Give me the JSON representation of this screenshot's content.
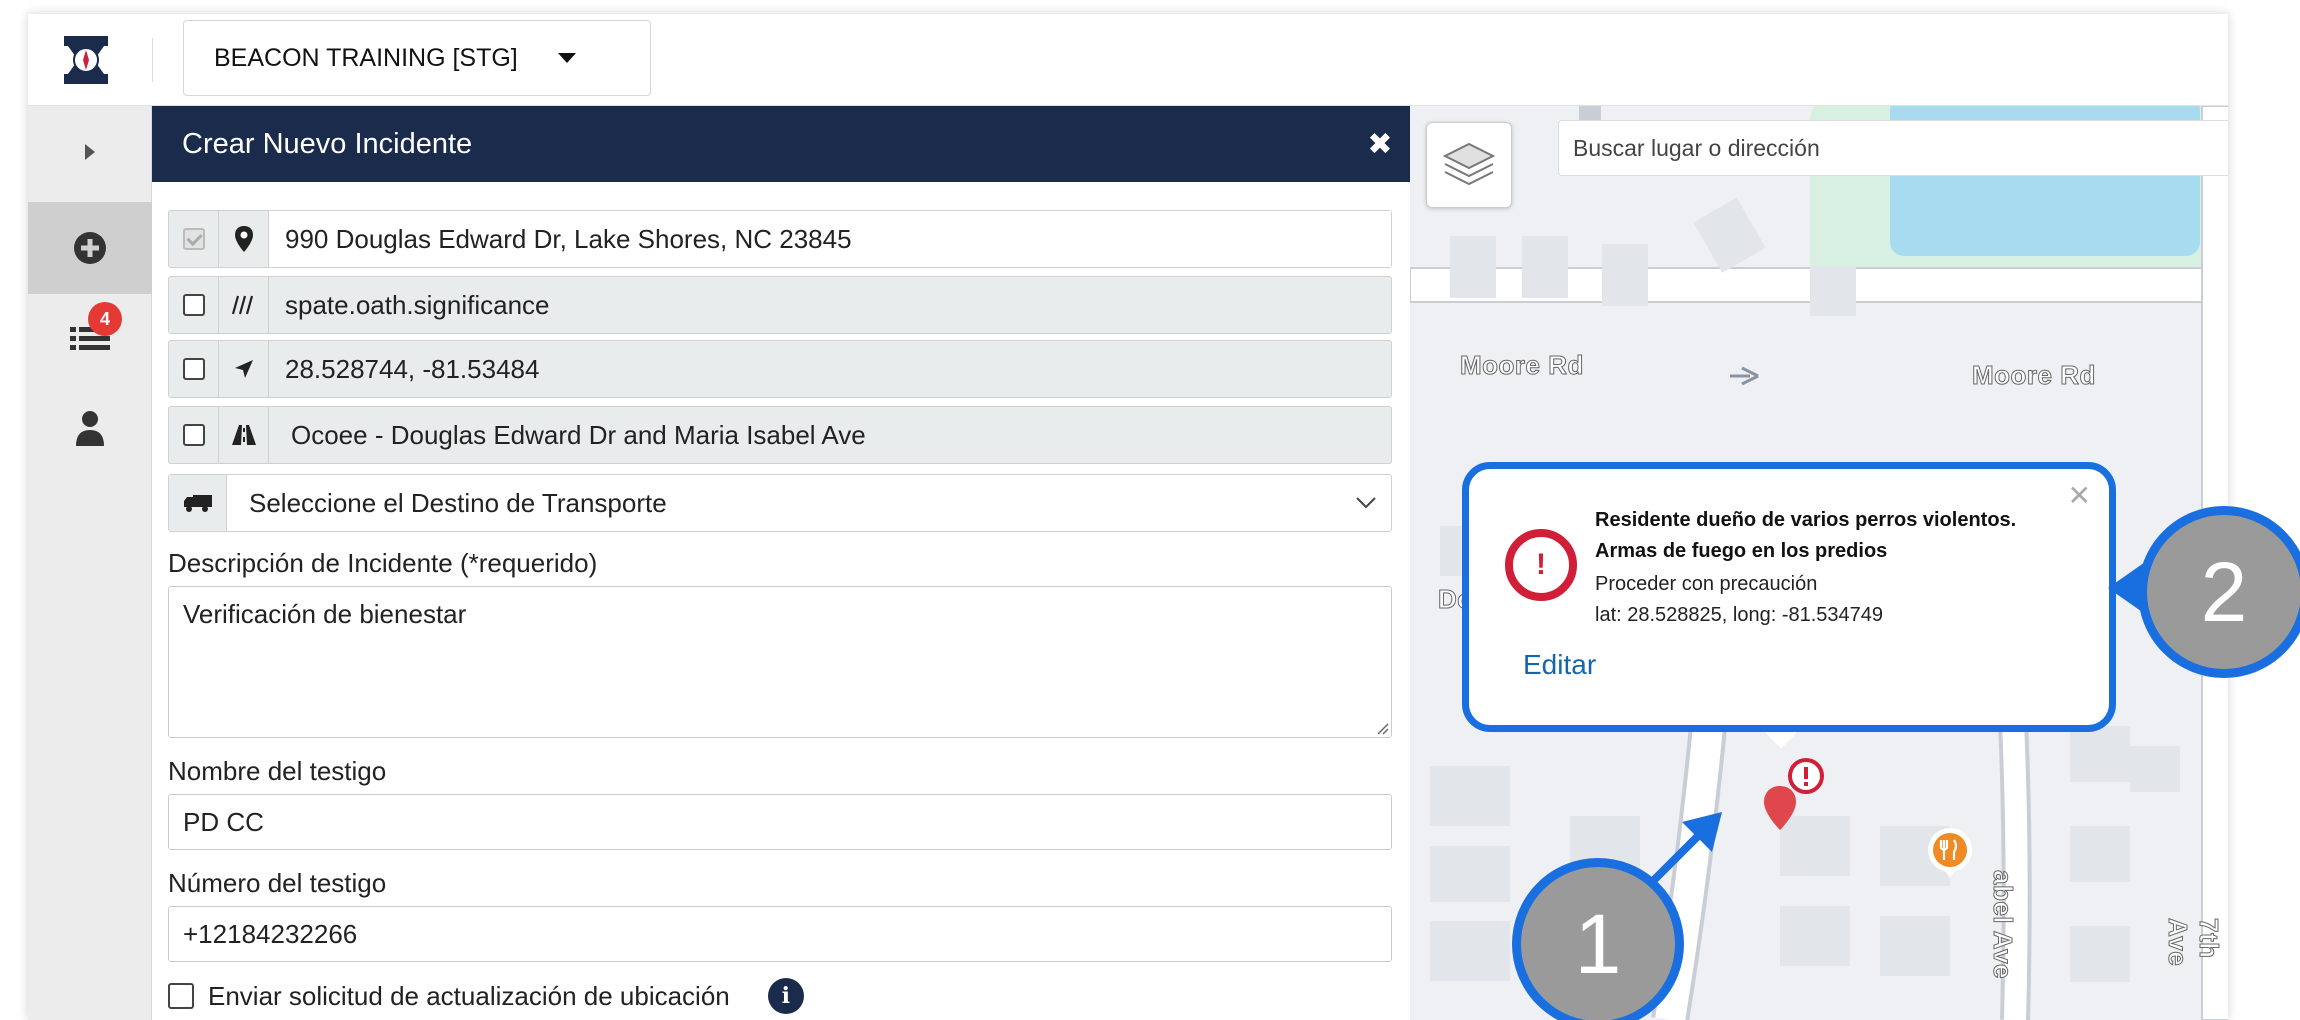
{
  "topbar": {
    "org_name": "BEACON TRAINING [STG]"
  },
  "sidebar": {
    "badge_count": "4"
  },
  "panel": {
    "title": "Crear Nuevo Incidente",
    "address": "990 Douglas Edward Dr, Lake Shores, NC 23845",
    "what3words": "spate.oath.significance",
    "coordinates": "28.528744, -81.53484",
    "intersection": "Ocoee -  Douglas Edward Dr and Maria Isabel Ave",
    "transport_placeholder": "Seleccione el Destino de Transporte",
    "description_label": "Descripción de Incidente (*requerido)",
    "description_value": "Verificación de bienestar",
    "witness_name_label": "Nombre del testigo",
    "witness_name_value": "PD CC",
    "witness_number_label": "Número del testigo",
    "witness_number_value": "+12184232266",
    "location_request_label": "Enviar solicitud de actualización de ubicación"
  },
  "map": {
    "search_placeholder": "Buscar lugar o dirección",
    "roads": [
      "Moore Rd",
      "Moore Rd",
      "Dc",
      "abel Ave",
      "7th Ave"
    ],
    "popup": {
      "title": "Residente dueño de varios perros violentos. Armas de fuego en los predios",
      "note": "Proceder con precaución",
      "coords": "lat: 28.528825, long: -81.534749",
      "edit_label": "Editar"
    },
    "alert_color": "#d01f36",
    "marker_color": "#e0474c",
    "poi_color": "#f08a24"
  },
  "callouts": [
    "1",
    "2"
  ],
  "colors": {
    "header_bg": "#1a2b4c",
    "callout_border": "#1a6fe0",
    "callout_fill": "#9a9a9a"
  }
}
